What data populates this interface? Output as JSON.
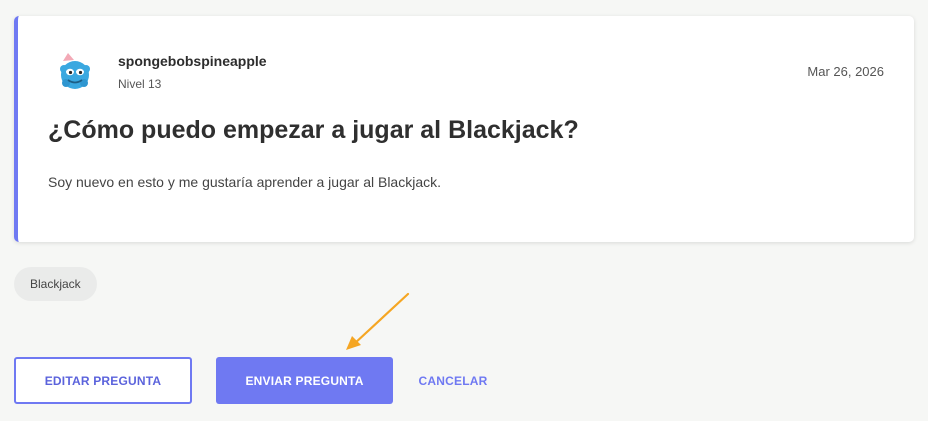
{
  "post": {
    "username": "spongebobspineapple",
    "level": "Nivel 13",
    "date": "Mar 26, 2026",
    "title": "¿Cómo puedo empezar a jugar al Blackjack?",
    "body": "Soy nuevo en esto y me gustaría aprender a jugar al Blackjack.",
    "avatar_icon": "blue-creature-avatar-icon"
  },
  "tags": [
    "Blackjack"
  ],
  "actions": {
    "edit_label": "EDITAR PREGUNTA",
    "send_label": "ENVIAR PREGUNTA",
    "cancel_label": "CANCELAR"
  },
  "colors": {
    "accent": "#6f79f2",
    "annotation_arrow": "#f5a623",
    "background": "#f6f7f5"
  }
}
